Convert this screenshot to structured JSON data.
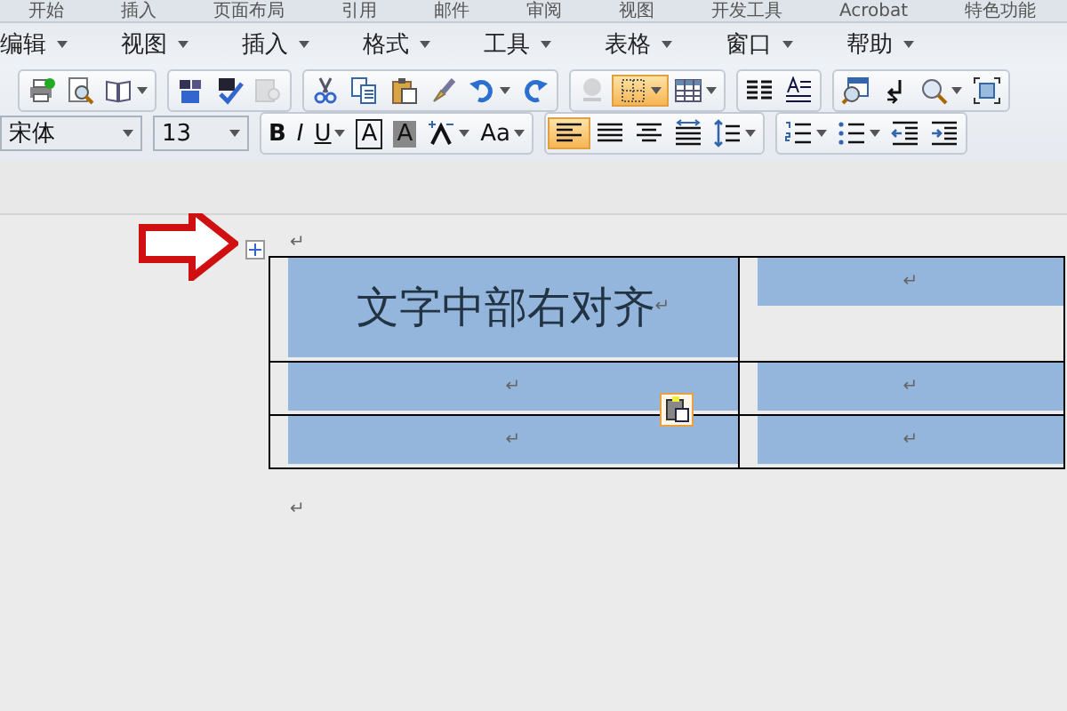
{
  "tabs": [
    {
      "label": "开始",
      "selected": false
    },
    {
      "label": "插入",
      "selected": false
    },
    {
      "label": "页面布局",
      "selected": false
    },
    {
      "label": "引用",
      "selected": false
    },
    {
      "label": "邮件",
      "selected": false
    },
    {
      "label": "审阅",
      "selected": false
    },
    {
      "label": "视图",
      "selected": false
    },
    {
      "label": "开发工具",
      "selected": false
    },
    {
      "label": "Acrobat",
      "selected": false
    },
    {
      "label": "特色功能",
      "selected": false
    }
  ],
  "menu": [
    {
      "label": "编辑"
    },
    {
      "label": "视图"
    },
    {
      "label": "插入"
    },
    {
      "label": "格式"
    },
    {
      "label": "工具"
    },
    {
      "label": "表格"
    },
    {
      "label": "窗口"
    },
    {
      "label": "帮助"
    }
  ],
  "toolbar_1": [
    [
      {
        "kind": "print",
        "selected": false,
        "disabled": false,
        "dropdown": false
      },
      {
        "kind": "preview",
        "selected": false,
        "disabled": false,
        "dropdown": false
      },
      {
        "kind": "reading",
        "selected": false,
        "disabled": false,
        "dropdown": true
      }
    ],
    [
      {
        "kind": "research",
        "selected": false,
        "disabled": false,
        "dropdown": false
      },
      {
        "kind": "spelling",
        "selected": false,
        "disabled": false,
        "dropdown": false
      },
      {
        "kind": "translate",
        "selected": false,
        "disabled": true,
        "dropdown": false
      }
    ],
    [
      {
        "kind": "cut",
        "selected": false,
        "disabled": false,
        "dropdown": false
      },
      {
        "kind": "copy",
        "selected": false,
        "disabled": false,
        "dropdown": false
      },
      {
        "kind": "paste",
        "selected": false,
        "disabled": false,
        "dropdown": false
      },
      {
        "kind": "painter",
        "selected": false,
        "disabled": false,
        "dropdown": false
      },
      {
        "kind": "undo",
        "selected": false,
        "disabled": false,
        "dropdown": true
      },
      {
        "kind": "redo",
        "selected": false,
        "disabled": false,
        "dropdown": false
      }
    ],
    [
      {
        "kind": "hyperlink",
        "selected": false,
        "disabled": true,
        "dropdown": false
      },
      {
        "kind": "borders",
        "selected": true,
        "disabled": false,
        "dropdown": true
      },
      {
        "kind": "table",
        "selected": false,
        "disabled": false,
        "dropdown": true
      }
    ],
    [
      {
        "kind": "columns",
        "selected": false,
        "disabled": false,
        "dropdown": false
      },
      {
        "kind": "textdir",
        "selected": false,
        "disabled": false,
        "dropdown": false
      }
    ],
    [
      {
        "kind": "docmap",
        "selected": false,
        "disabled": false,
        "dropdown": false
      },
      {
        "kind": "marks",
        "selected": false,
        "disabled": false,
        "dropdown": false
      },
      {
        "kind": "zoom",
        "selected": false,
        "disabled": false,
        "dropdown": true
      },
      {
        "kind": "fullscreen",
        "selected": false,
        "disabled": false,
        "dropdown": false
      }
    ]
  ],
  "font": {
    "name": "宋体",
    "size": "13"
  },
  "toolbar_2": [
    [
      {
        "kind": "bold",
        "label": "B",
        "selected": false,
        "disabled": false,
        "dropdown": false
      },
      {
        "kind": "italic",
        "label": "I",
        "selected": false,
        "disabled": false,
        "dropdown": false
      },
      {
        "kind": "underline",
        "label": "U",
        "selected": false,
        "disabled": false,
        "dropdown": true
      },
      {
        "kind": "boxed",
        "label": "A",
        "selected": false,
        "disabled": false,
        "dropdown": false
      },
      {
        "kind": "shaded",
        "label": "A",
        "selected": false,
        "disabled": false,
        "dropdown": false
      },
      {
        "kind": "scale",
        "selected": false,
        "disabled": false,
        "dropdown": true
      },
      {
        "kind": "case",
        "label": "Aa",
        "selected": false,
        "disabled": false,
        "dropdown": true
      }
    ],
    [
      {
        "kind": "left",
        "selected": true,
        "disabled": false,
        "dropdown": false
      },
      {
        "kind": "center",
        "selected": false,
        "disabled": false,
        "dropdown": false
      },
      {
        "kind": "right",
        "selected": false,
        "disabled": false,
        "dropdown": false
      },
      {
        "kind": "distributed",
        "selected": false,
        "disabled": false,
        "dropdown": false
      },
      {
        "kind": "spacing",
        "selected": false,
        "disabled": false,
        "dropdown": true
      }
    ],
    [
      {
        "kind": "numbering",
        "selected": false,
        "disabled": false,
        "dropdown": true
      },
      {
        "kind": "bullets",
        "selected": false,
        "disabled": false,
        "dropdown": true
      },
      {
        "kind": "outdent",
        "selected": false,
        "disabled": false,
        "dropdown": false
      },
      {
        "kind": "indent",
        "selected": false,
        "disabled": false,
        "dropdown": false
      }
    ]
  ],
  "document": {
    "mark_before": "↵",
    "table": {
      "rows": [
        {
          "cells": [
            {
              "text": "文字中部右对齐",
              "mark": "↵",
              "selected": true
            },
            {
              "mark": "↵",
              "selected": true
            }
          ]
        },
        {
          "cells": [
            {
              "mark": "↵",
              "selected": true
            },
            {
              "mark": "↵",
              "selected": true
            }
          ]
        },
        {
          "cells": [
            {
              "mark": "↵",
              "selected": true
            },
            {
              "mark": "↵",
              "selected": true
            }
          ]
        }
      ]
    },
    "mark_after": "↵"
  }
}
